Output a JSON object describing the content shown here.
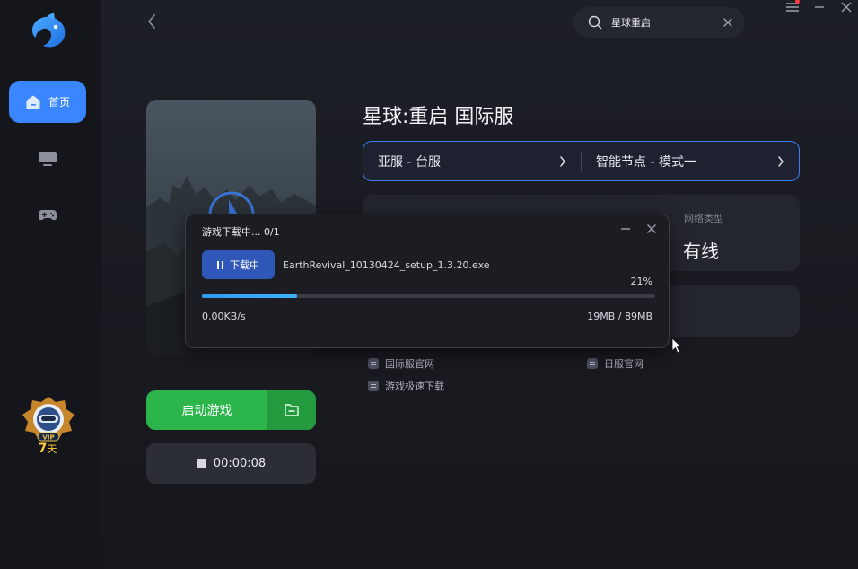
{
  "sidebar": {
    "home_label": "首页",
    "items": [
      {
        "icon": "home-icon",
        "label": "首页"
      },
      {
        "icon": "monitor-icon"
      },
      {
        "icon": "gamepad-icon"
      }
    ],
    "vip": {
      "badge_text": "VIP",
      "days_value": "7",
      "days_unit": "天"
    }
  },
  "search": {
    "value": "星球重启"
  },
  "game": {
    "title": "星球:重启 国际服",
    "server": "亚服 - 台服",
    "node": "智能节点 - 模式一",
    "network_type_label": "网络类型",
    "network_type_value": "有线",
    "links": [
      "国际服官网",
      "日服官网",
      "游戏极速下载"
    ]
  },
  "actions": {
    "start_label": "启动游戏",
    "timer": "00:00:08"
  },
  "download": {
    "title": "游戏下载中... 0/1",
    "status_label": "下载中",
    "file_name": "EarthRevival_10130424_setup_1.3.20.exe",
    "percent_text": "21%",
    "progress": 0.21,
    "speed": "0.00KB/s",
    "size": "19MB / 89MB"
  },
  "colors": {
    "accent": "#3a86ff",
    "start_green": "#2bb54b",
    "vip_gold": "#ffce3d"
  }
}
